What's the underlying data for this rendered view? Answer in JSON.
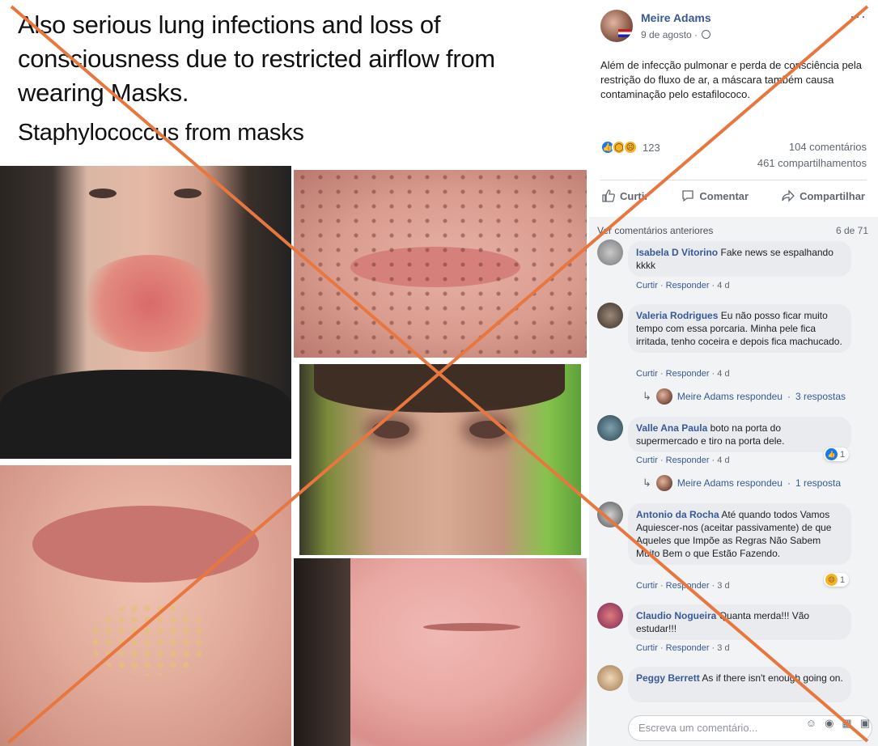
{
  "media": {
    "caption_main": "Also serious lung infections and loss of consciousness due to restricted airflow from wearing Masks.",
    "caption_sub": "Staphylococcus from masks"
  },
  "post": {
    "author": "Meire Adams",
    "date": "9 de agosto · ",
    "menu": "···",
    "text": "Além de infecção pulmonar e perda de consciência pela restrição do fluxo de ar, a máscara também causa contaminação pelo estafilococo.",
    "reaction_count": "123",
    "comments_count": "104 comentários",
    "shares_count": "461 compartilhamentos",
    "actions": {
      "like": "Curtir",
      "comment": "Comentar",
      "share": "Compartilhar"
    }
  },
  "comments": {
    "prev_label": "Ver comentários anteriores",
    "pager": "6 de 71",
    "meta_like": "Curtir",
    "meta_reply": "Responder",
    "items": [
      {
        "name": "Isabela D Vitorino",
        "text": "Fake news se espalhando kkkk",
        "age": "4 d"
      },
      {
        "name": "Valeria Rodrigues",
        "text": "Eu não posso ficar muito tempo com essa porcaria. Minha pele fica irritada, tenho coceira e depois fica machucado.",
        "age": "4 d",
        "reply_author": "Meire Adams respondeu",
        "reply_count": "3 respostas"
      },
      {
        "name": "Valle Ana Paula",
        "text": "boto na porta do supermercado e tiro na porta dele.",
        "age": "4 d",
        "reaction": "1",
        "reply_author": "Meire Adams respondeu",
        "reply_count": "1 resposta"
      },
      {
        "name": "Antonio da Rocha",
        "text": "Até quando todos Vamos Aquiescer-nos (aceitar passivamente) de que Aqueles que Impõe as Regras Não Sabem Muito Bem o que Estão Fazendo.",
        "age": "3 d",
        "reaction": "1"
      },
      {
        "name": "Claudio Nogueira",
        "text": "Quanta merda!!! Vão estudar!!!",
        "age": "3 d"
      },
      {
        "name": "Peggy Berrett",
        "text": "As if there isn't enough going on."
      }
    ]
  },
  "composer": {
    "placeholder": "Escreva um comentário..."
  },
  "colors": {
    "cross": "#e8773f",
    "link": "#385898",
    "like": "#1877f2"
  }
}
